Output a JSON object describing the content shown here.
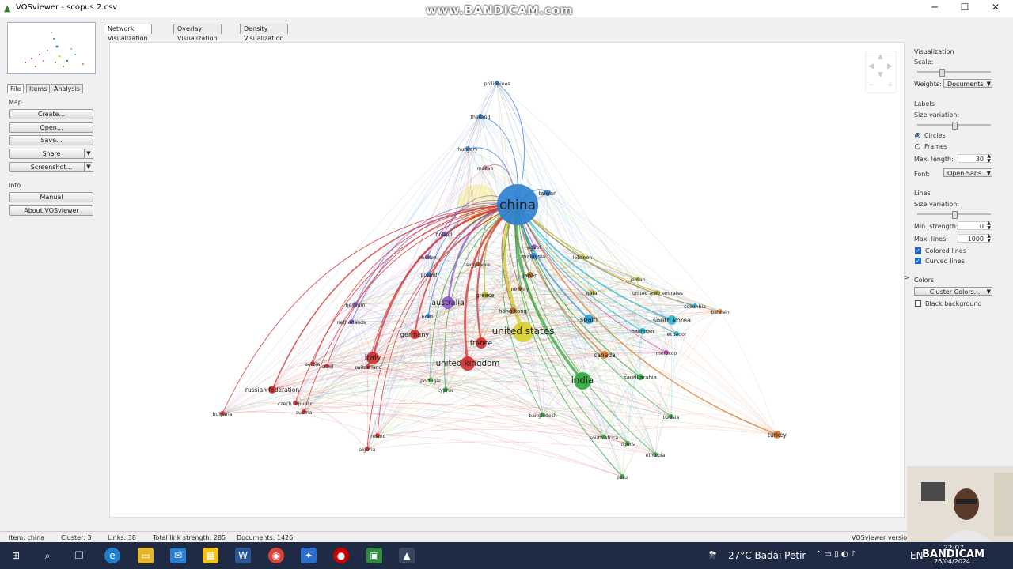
{
  "window": {
    "title": "VOSviewer - scopus 2.csv",
    "watermark": "www.BANDICAM.com",
    "minimize": "─",
    "maximize": "☐",
    "close": "✕"
  },
  "left": {
    "tabs": [
      "File",
      "Items",
      "Analysis"
    ],
    "map_header": "Map",
    "buttons": [
      "Create...",
      "Open...",
      "Save...",
      "Share",
      "Screenshot..."
    ],
    "info_header": "Info",
    "info_buttons": [
      "Manual",
      "About VOSviewer"
    ]
  },
  "view_tabs": [
    "Network Visualization",
    "Overlay Visualization",
    "Density Visualization"
  ],
  "right": {
    "visualization": "Visualization",
    "scale": "Scale:",
    "weights_label": "Weights:",
    "weights_value": "Documents",
    "labels": "Labels",
    "size_variation": "Size variation:",
    "circles": "Circles",
    "frames": "Frames",
    "max_length_label": "Max. length:",
    "max_length_value": "30",
    "font_label": "Font:",
    "font_value": "Open Sans",
    "lines": "Lines",
    "lines_size_variation": "Size variation:",
    "min_strength_label": "Min. strength:",
    "min_strength_value": "0",
    "max_lines_label": "Max. lines:",
    "max_lines_value": "1000",
    "colored_lines": "Colored lines",
    "curved_lines": "Curved lines",
    "colors": "Colors",
    "cluster_colors": "Cluster Colors...",
    "black_background": "Black background"
  },
  "status": {
    "item": "Item:   china",
    "cluster": "Cluster:   3",
    "links": "Links:   38",
    "total_link_strength": "Total link strength:   285",
    "documents": "Documents:   1426",
    "version": "VOSviewer version 1"
  },
  "taskbar": {
    "weather": "27°C  Badai Petir",
    "lang": "EN",
    "time": "22:07",
    "date": "26/04/2024",
    "bandicam": "BANDICAM"
  },
  "network": {
    "center": "china",
    "nodes": [
      {
        "label": "china",
        "color": "#2a7fd0",
        "size": 26,
        "big": true
      },
      {
        "label": "united states",
        "color": "#d8cf2a",
        "size": 13
      },
      {
        "label": "india",
        "color": "#2ea83a",
        "size": 11
      },
      {
        "label": "united kingdom",
        "color": "#d42a2a",
        "size": 9
      },
      {
        "label": "australia",
        "color": "#8a5ac8",
        "size": 8
      },
      {
        "label": "italy",
        "color": "#d42a2a",
        "size": 8
      },
      {
        "label": "france",
        "color": "#d42a2a",
        "size": 7
      },
      {
        "label": "germany",
        "color": "#d42a2a",
        "size": 6
      },
      {
        "label": "spain",
        "color": "#2a9ad8",
        "size": 6
      },
      {
        "label": "south korea",
        "color": "#2ab8d0",
        "size": 6
      },
      {
        "label": "russian federation",
        "color": "#d42a2a",
        "size": 5
      },
      {
        "label": "canada",
        "color": "#e07a2a",
        "size": 5
      },
      {
        "label": "turkey",
        "color": "#e07a2a",
        "size": 5
      },
      {
        "label": "greece",
        "color": "#a8b82a",
        "size": 4
      },
      {
        "label": "hong kong",
        "color": "#a8662a",
        "size": 4
      },
      {
        "label": "saudi arabia",
        "color": "#2ea83a",
        "size": 4
      },
      {
        "label": "pakistan",
        "color": "#2ab8d0",
        "size": 4
      },
      {
        "label": "taiwan",
        "color": "#2a7fd0",
        "size": 4
      },
      {
        "label": "japan",
        "color": "#a8662a",
        "size": 4
      },
      {
        "label": "malaysia",
        "color": "#2a7fd0",
        "size": 4
      },
      {
        "label": "morocco",
        "color": "#c83aa8",
        "size": 3
      },
      {
        "label": "united arab emirates",
        "color": "#b8b82a",
        "size": 3
      },
      {
        "label": "jordan",
        "color": "#b8b82a",
        "size": 3
      },
      {
        "label": "norway",
        "color": "#a8662a",
        "size": 3
      },
      {
        "label": "singapore",
        "color": "#a8662a",
        "size": 3
      },
      {
        "label": "poland",
        "color": "#2a7fd0",
        "size": 3
      },
      {
        "label": "sweden",
        "color": "#8a5ac8",
        "size": 3
      },
      {
        "label": "finland",
        "color": "#8a5ac8",
        "size": 3
      },
      {
        "label": "egypt",
        "color": "#8a5ac8",
        "size": 3
      },
      {
        "label": "thailand",
        "color": "#2a7fd0",
        "size": 3
      },
      {
        "label": "philippines",
        "color": "#2a7fd0",
        "size": 3
      },
      {
        "label": "hungary",
        "color": "#2a7fd0",
        "size": 3
      },
      {
        "label": "macao",
        "color": "#c87a9a",
        "size": 3
      },
      {
        "label": "qatar",
        "color": "#b8b82a",
        "size": 3
      },
      {
        "label": "lebanon",
        "color": "#b8b82a",
        "size": 3
      },
      {
        "label": "colombia",
        "color": "#2ab8d0",
        "size": 3
      },
      {
        "label": "ecuador",
        "color": "#2ab8d0",
        "size": 3
      },
      {
        "label": "bahrain",
        "color": "#e07a2a",
        "size": 3
      },
      {
        "label": "belgium",
        "color": "#8a5ac8",
        "size": 3
      },
      {
        "label": "netherlands",
        "color": "#8a5ac8",
        "size": 3
      },
      {
        "label": "brazil",
        "color": "#2a7fd0",
        "size": 3
      },
      {
        "label": "serbia",
        "color": "#d42a2a",
        "size": 3
      },
      {
        "label": "israel",
        "color": "#d42a2a",
        "size": 3
      },
      {
        "label": "switzerland",
        "color": "#d42a2a",
        "size": 3
      },
      {
        "label": "portugal",
        "color": "#2ea83a",
        "size": 3
      },
      {
        "label": "cyprus",
        "color": "#2ea83a",
        "size": 3
      },
      {
        "label": "czech republic",
        "color": "#d42a2a",
        "size": 3
      },
      {
        "label": "austria",
        "color": "#d42a2a",
        "size": 3
      },
      {
        "label": "bulgaria",
        "color": "#d42a2a",
        "size": 3
      },
      {
        "label": "ireland",
        "color": "#d42a2a",
        "size": 3
      },
      {
        "label": "algeria",
        "color": "#d42a2a",
        "size": 3
      },
      {
        "label": "bangladesh",
        "color": "#2ea83a",
        "size": 3
      },
      {
        "label": "south africa",
        "color": "#2ea83a",
        "size": 3
      },
      {
        "label": "nigeria",
        "color": "#2ea83a",
        "size": 3
      },
      {
        "label": "ethiopia",
        "color": "#2ea83a",
        "size": 3
      },
      {
        "label": "tunisia",
        "color": "#2ea83a",
        "size": 3
      },
      {
        "label": "peru",
        "color": "#2ea83a",
        "size": 3
      }
    ]
  }
}
